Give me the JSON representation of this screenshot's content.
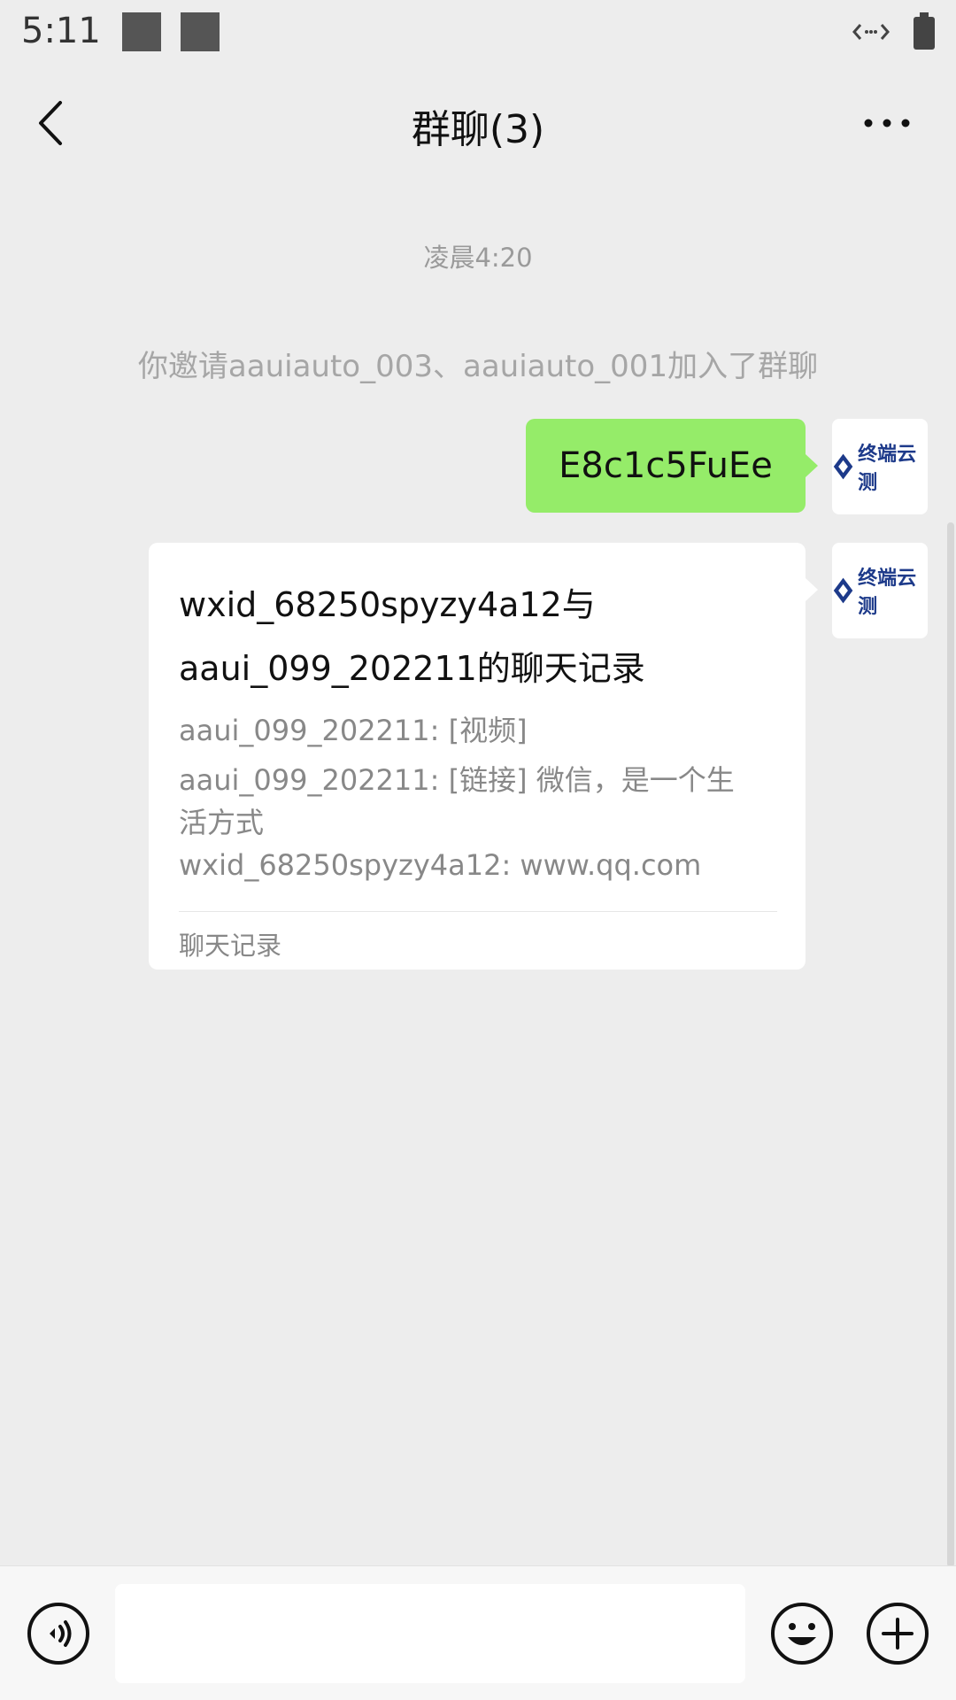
{
  "status_bar": {
    "time": "5:11"
  },
  "header": {
    "title": "群聊(3)"
  },
  "chat": {
    "time_label": "凌晨4:20",
    "system_message": "你邀请aauiauto_003、aauiauto_001加入了群聊",
    "avatar_text": "终端云测",
    "messages": [
      {
        "type": "text",
        "text": "E8c1c5FuEe"
      },
      {
        "type": "chat_record",
        "title_line1": "wxid_68250spyzy4a12与",
        "title_line2": "aaui_099_202211的聊天记录",
        "lines": [
          "aaui_099_202211: [视频]",
          "aaui_099_202211: [链接] 微信，是一个生",
          "活方式",
          "wxid_68250spyzy4a12: www.qq.com"
        ],
        "footer": "聊天记录"
      }
    ]
  },
  "input_bar": {
    "value": "",
    "placeholder": ""
  },
  "colors": {
    "background": "#ededed",
    "sent_bubble": "#95ec69",
    "card": "#ffffff"
  }
}
